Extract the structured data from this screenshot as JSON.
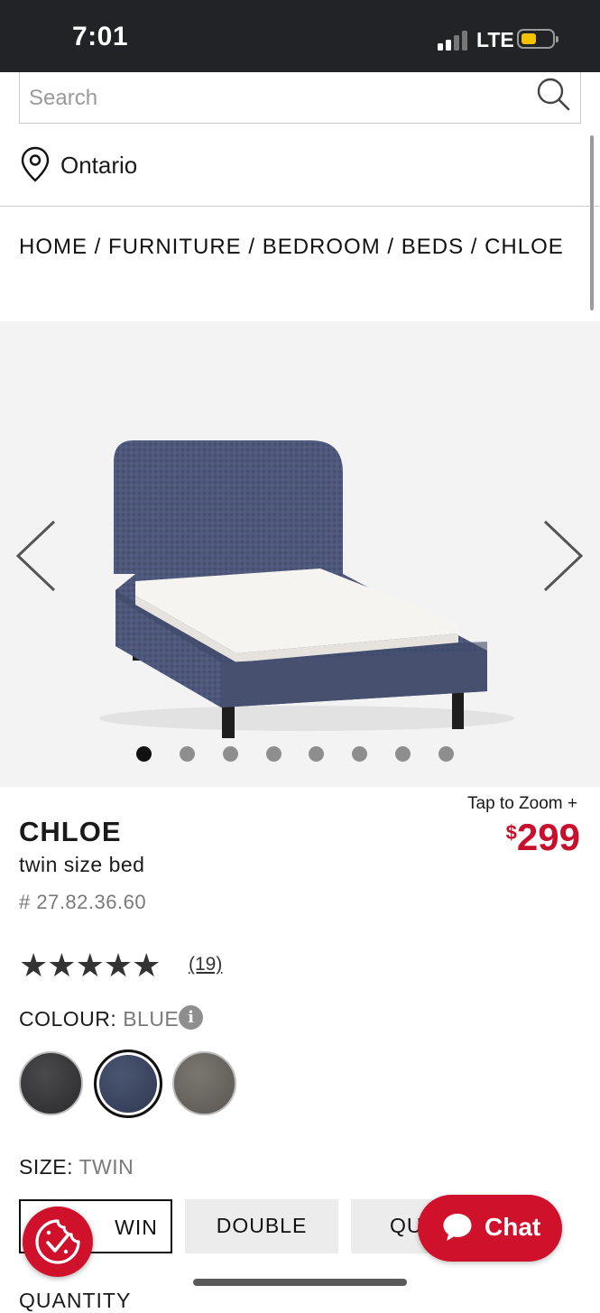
{
  "status_bar": {
    "time": "7:01",
    "network": "LTE",
    "battery_level": 0.45
  },
  "search": {
    "placeholder": "Search",
    "value": ""
  },
  "location": {
    "label": "Ontario"
  },
  "breadcrumb": {
    "items": [
      "HOME",
      "FURNITURE",
      "BEDROOM",
      "BEDS",
      "CHLOE"
    ],
    "separator": " / "
  },
  "gallery": {
    "image_count": 8,
    "active_index": 0,
    "zoom_label": "Tap to Zoom  +"
  },
  "product": {
    "name": "CHLOE",
    "subtitle": "twin size bed",
    "sku": "# 27.82.36.60",
    "price_currency": "$",
    "price_amount": "299",
    "rating": 5,
    "reviews": "(19)"
  },
  "colour": {
    "label": "COLOUR:",
    "selected": "BLUE",
    "info_icon": "i",
    "swatches": [
      {
        "name": "charcoal",
        "color": "#38383a"
      },
      {
        "name": "blue",
        "color": "#3c4560"
      },
      {
        "name": "grey",
        "color": "#69655f"
      }
    ]
  },
  "size": {
    "label": "SIZE:",
    "selected": "TWIN",
    "options": [
      "WIN",
      "DOUBLE",
      "QU"
    ]
  },
  "quantity": {
    "label": "QUANTITY"
  },
  "chat": {
    "label": "Chat"
  },
  "colors": {
    "brand_red": "#d0112b",
    "price_red": "#c8102e",
    "status_bar": "#222326"
  }
}
